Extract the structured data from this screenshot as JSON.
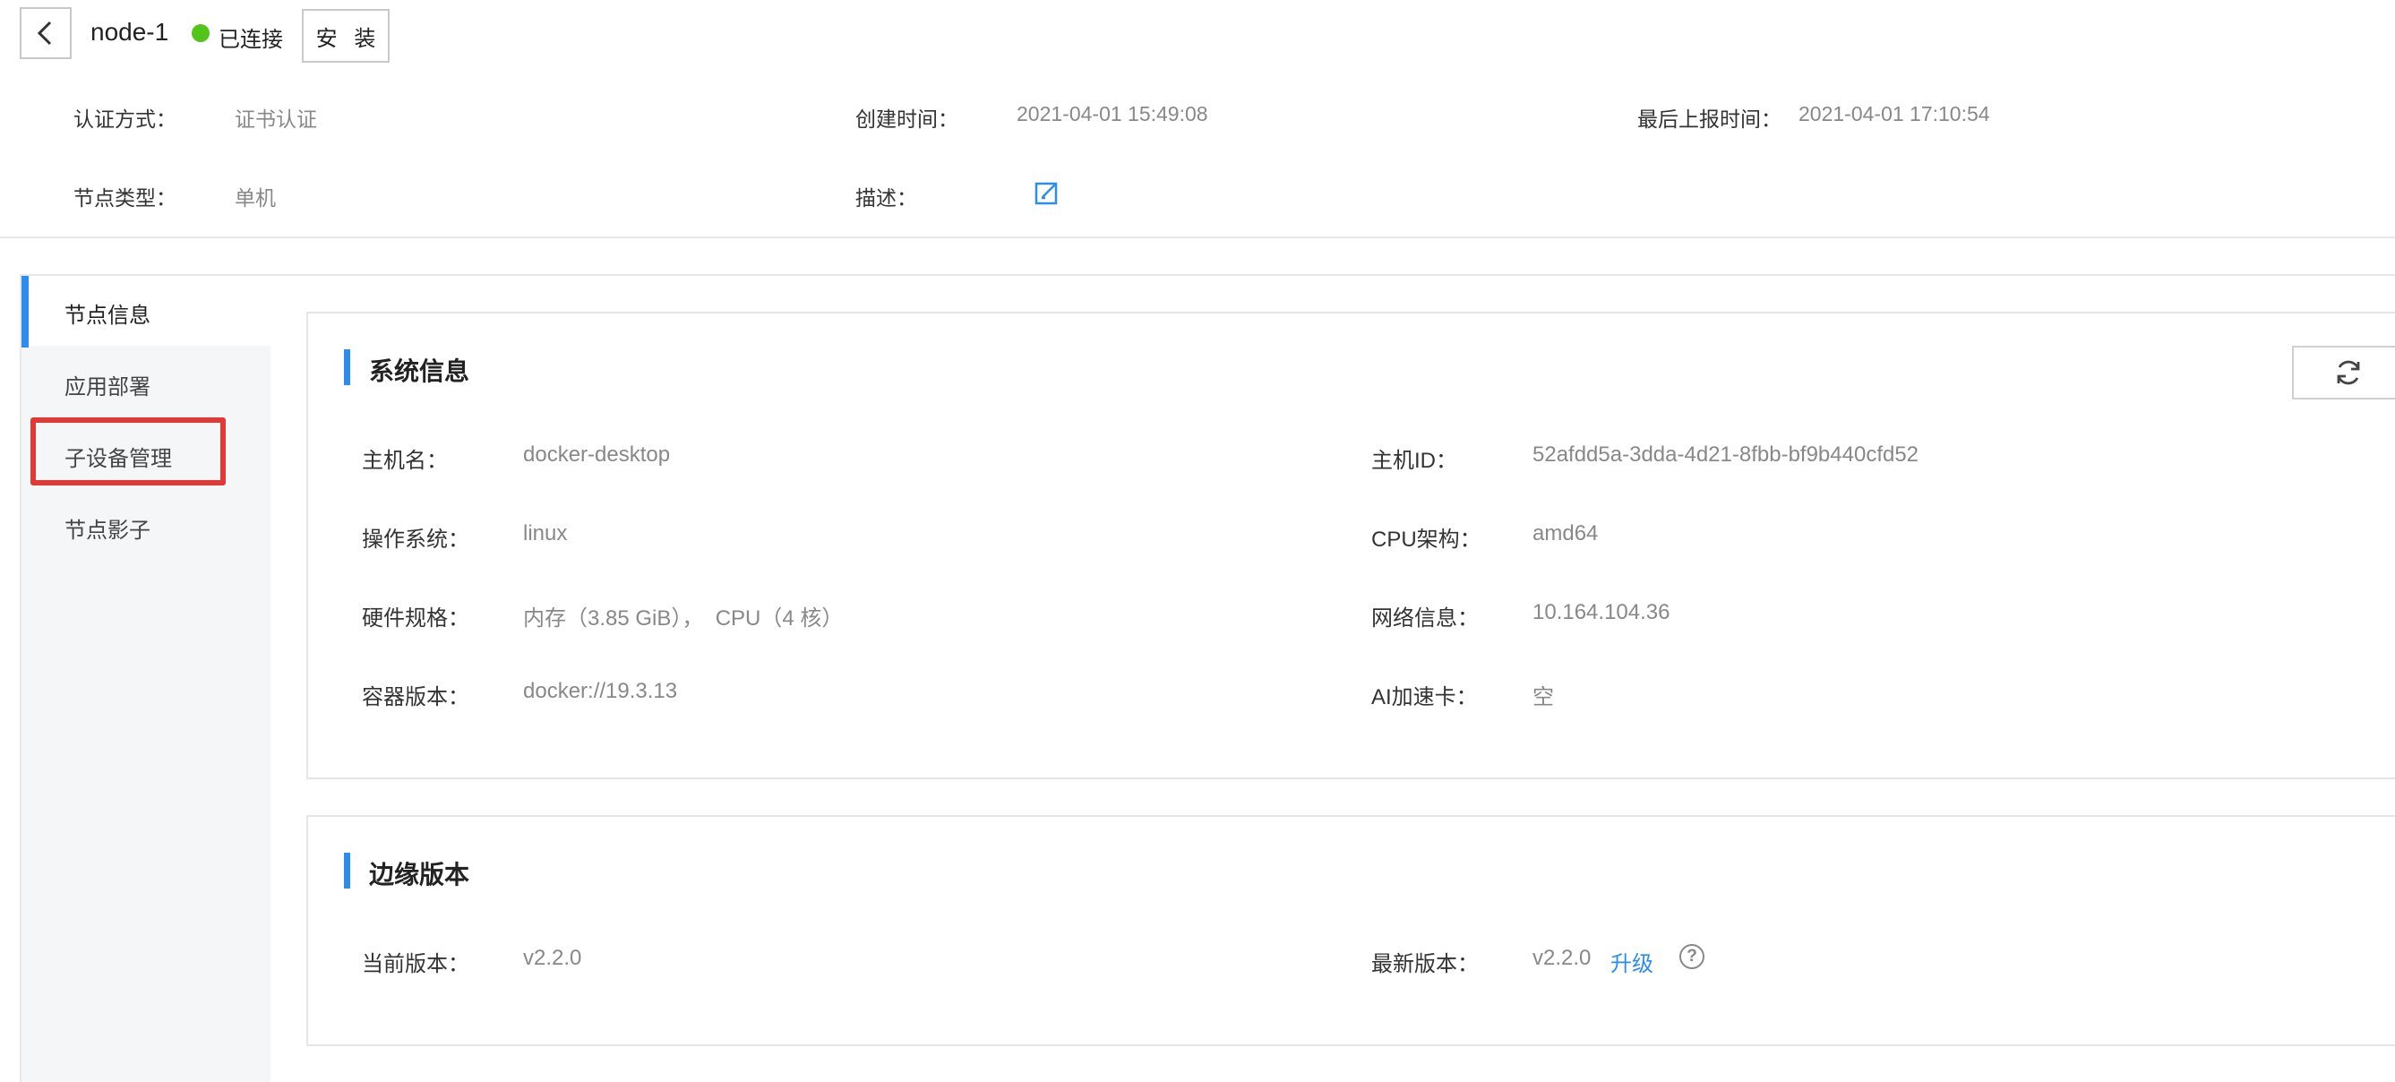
{
  "header": {
    "node_name": "node-1",
    "status": "已连接",
    "status_color": "#52c41a",
    "install_label": "安 装"
  },
  "meta": {
    "auth_label": "认证方式：",
    "auth_value": "证书认证",
    "created_label": "创建时间：",
    "created_value": "2021-04-01 15:49:08",
    "last_report_label": "最后上报时间：",
    "last_report_value": "2021-04-01 17:10:54",
    "type_label": "节点类型：",
    "type_value": "单机",
    "desc_label": "描述："
  },
  "sidebar": {
    "items": [
      {
        "label": "节点信息",
        "active": true
      },
      {
        "label": "应用部署"
      },
      {
        "label": "子设备管理",
        "highlighted": true
      },
      {
        "label": "节点影子"
      }
    ]
  },
  "system_info": {
    "title": "系统信息",
    "rows": [
      {
        "label": "主机名：",
        "value": "docker-desktop"
      },
      {
        "label": "主机ID：",
        "value": "52afdd5a-3dda-4d21-8fbb-bf9b440cfd52"
      },
      {
        "label": "操作系统：",
        "value": "linux"
      },
      {
        "label": "CPU架构：",
        "value": "amd64"
      },
      {
        "label": "硬件规格：",
        "value": "内存（3.85 GiB），  CPU（4 核）"
      },
      {
        "label": "网络信息：",
        "value": "10.164.104.36"
      },
      {
        "label": "容器版本：",
        "value": "docker://19.3.13"
      },
      {
        "label": "AI加速卡：",
        "value": "空"
      }
    ]
  },
  "edge_version": {
    "title": "边缘版本",
    "current_label": "当前版本：",
    "current_value": "v2.2.0",
    "latest_label": "最新版本：",
    "latest_value": "v2.2.0",
    "upgrade_label": "升级",
    "help_glyph": "?"
  },
  "colors": {
    "accent": "#2d8cf0",
    "highlight": "#e03a36"
  }
}
